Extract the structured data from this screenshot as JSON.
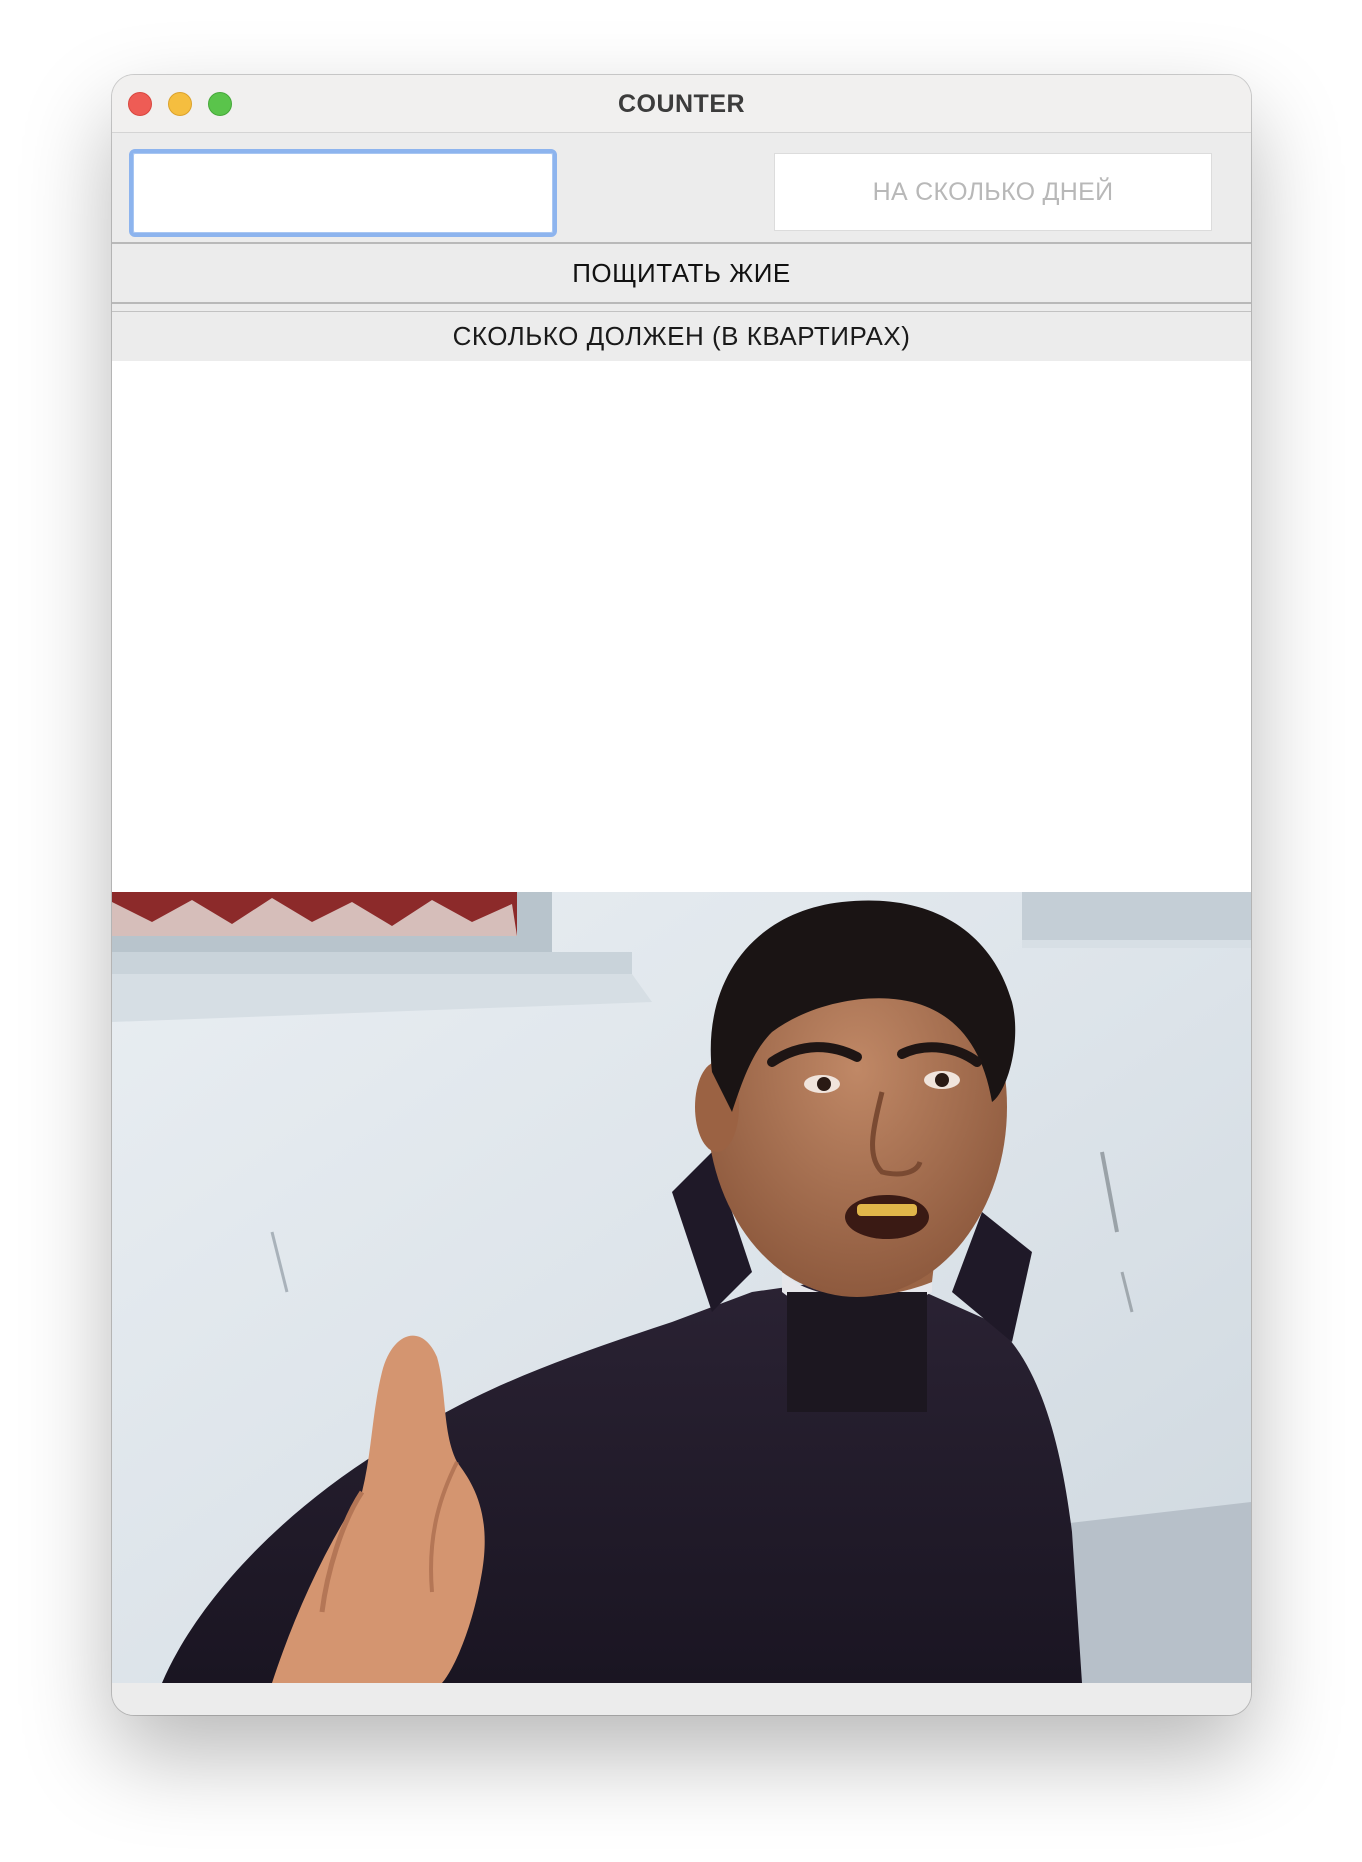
{
  "window": {
    "title": "COUNTER",
    "controls": [
      "close-button",
      "minimize-button",
      "zoom-button"
    ]
  },
  "amount_input": {
    "value": "",
    "placeholder": ""
  },
  "days_input": {
    "value": "",
    "placeholder": "НА СКОЛЬКО ДНЕЙ"
  },
  "count_button": {
    "label": "ПОЩИТАТЬ ЖИЕ"
  },
  "result_label": {
    "text": "СКОЛЬКО ДОЛЖЕН (В КВАРТИРАХ)"
  },
  "result_output": {
    "value": ""
  },
  "photo": {
    "subject": "man in dark jacket gesturing with open hand in front of a white wall"
  }
}
